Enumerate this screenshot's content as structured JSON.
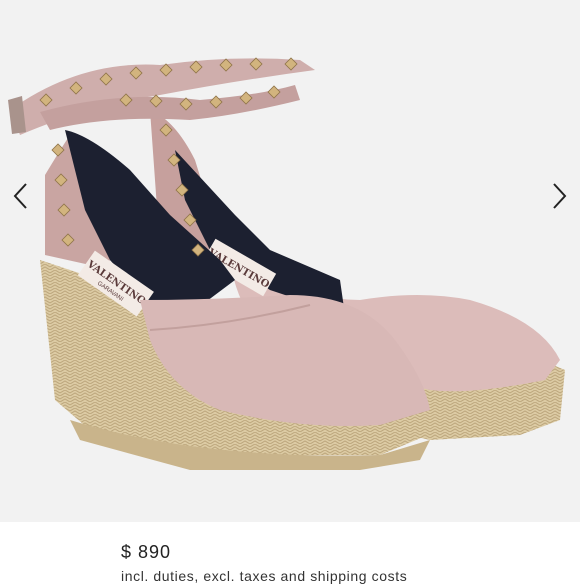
{
  "gallery": {
    "image": {
      "description_icon": "shoe-product-photo",
      "colors": {
        "background": "#f2f2f2",
        "leather": "#d9bbb8",
        "strap": "#c7a3a0",
        "jute": "#d8c7a0",
        "stud": "#cfb07a",
        "lining": "#1c2030"
      }
    },
    "prev_icon": "chevron-left-icon",
    "next_icon": "chevron-right-icon"
  },
  "label": {
    "brand": "VALENTINO",
    "garavani": "GARAVANI"
  },
  "product": {
    "price": "$ 890",
    "price_note": "incl. duties, excl. taxes and shipping costs"
  }
}
